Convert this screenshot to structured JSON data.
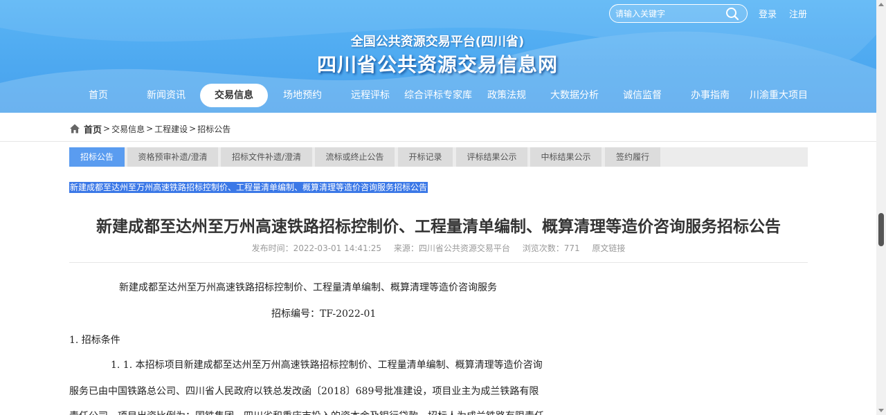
{
  "header": {
    "search": {
      "placeholder": "请输入关键字"
    },
    "login_label": "登录",
    "register_label": "注册",
    "subtitle": "全国公共资源交易平台(四川省)",
    "title": "四川省公共资源交易信息网"
  },
  "nav": {
    "items": [
      {
        "label": "首页"
      },
      {
        "label": "新闻资讯"
      },
      {
        "label": "交易信息"
      },
      {
        "label": "场地预约"
      },
      {
        "label": "远程评标"
      },
      {
        "label": "综合评标专家库"
      },
      {
        "label": "政策法规"
      },
      {
        "label": "大数据分析"
      },
      {
        "label": "诚信监督"
      },
      {
        "label": "办事指南"
      },
      {
        "label": "川渝重大项目"
      }
    ],
    "active_index": 2
  },
  "breadcrumb": {
    "items": [
      "首页",
      "交易信息",
      "工程建设",
      "招标公告"
    ],
    "separator": ">"
  },
  "tabs": {
    "items": [
      {
        "label": "招标公告"
      },
      {
        "label": "资格预审补遗/澄清"
      },
      {
        "label": "招标文件补遗/澄清"
      },
      {
        "label": "流标或终止公告"
      },
      {
        "label": "开标记录"
      },
      {
        "label": "评标结果公示"
      },
      {
        "label": "中标结果公示"
      },
      {
        "label": "签约履行"
      }
    ],
    "active_index": 0
  },
  "selected_link": "新建成都至达州至万州高速铁路招标控制价、工程量清单编制、概算清理等造价咨询服务招标公告",
  "article": {
    "title": "新建成都至达州至万州高速铁路招标控制价、工程量清单编制、概算清理等造价咨询服务招标公告",
    "meta": {
      "published": "发布时间：2022-03-01 14:41:25",
      "source": "来源：四川省公共资源交易平台",
      "views": "浏览次数：771",
      "original_link": "原文链接"
    },
    "lines": [
      "新建成都至达州至万州高速铁路招标控制价、工程量清单编制、概算清理等造价咨询服务",
      "招标编号：TF-2022-01",
      "1. 招标条件",
      "1. 1. 本招标项目新建成都至达州至万州高速铁路招标控制价、工程量清单编制、概算清理等造价咨询",
      "服务已由中国铁路总公司、四川省人民政府以铁总发改函〔2018〕689号批准建设，项目业主为成兰铁路有限",
      "责任公司，项目出资比例为：国铁集团、四川省和重庆市投入的资本金及银行贷款，招标人为成兰铁路有限责任"
    ]
  },
  "colors": {
    "header_blue": "#4da8f0",
    "active_tab": "#5a9cf0",
    "selection": "#3b78e7"
  }
}
